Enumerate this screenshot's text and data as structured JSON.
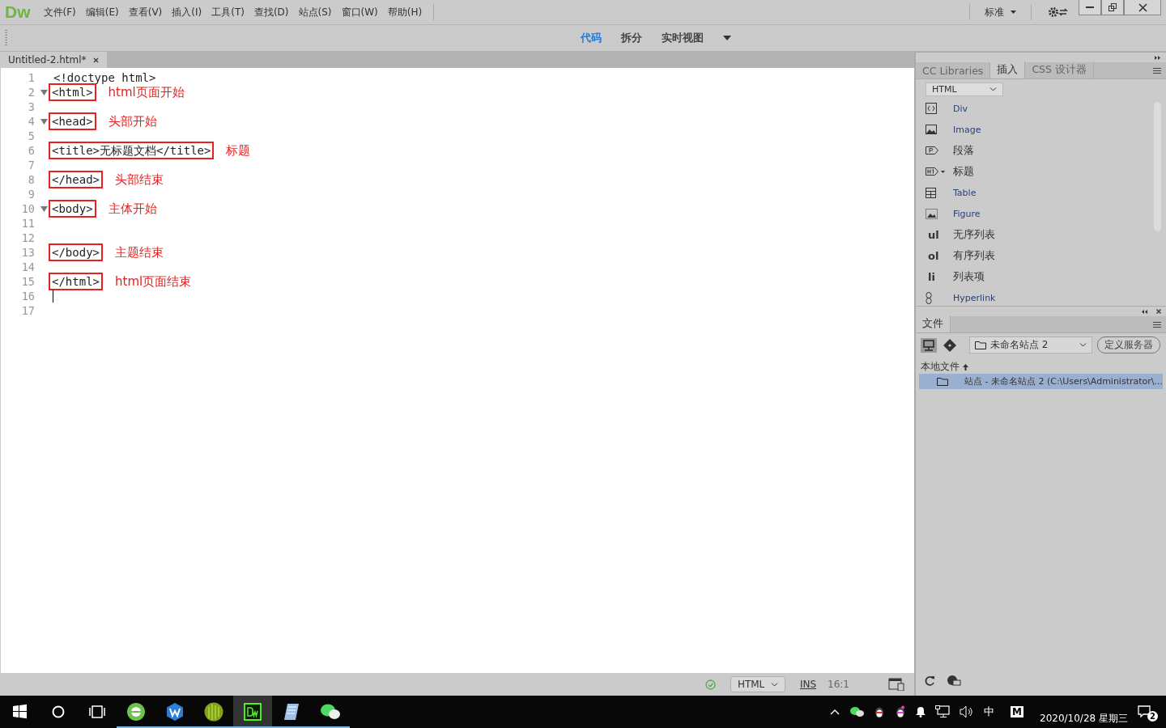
{
  "app_logo": "Dw",
  "menu": [
    "文件(F)",
    "编辑(E)",
    "查看(V)",
    "插入(I)",
    "工具(T)",
    "查找(D)",
    "站点(S)",
    "窗口(W)",
    "帮助(H)"
  ],
  "workspace": "标准",
  "view_modes": [
    {
      "label": "代码",
      "selected": true
    },
    {
      "label": "拆分",
      "selected": false
    },
    {
      "label": "实时视图",
      "selected": false
    }
  ],
  "document_tab": {
    "title": "Untitled-2.html*"
  },
  "code_lines": [
    {
      "number": "1",
      "code": "<!doctype html>",
      "fold": false,
      "boxed": false
    },
    {
      "number": "2",
      "code": "<html>",
      "fold": true,
      "boxed": true,
      "note": "html页面开始"
    },
    {
      "number": "3",
      "fold": false,
      "boxed": false
    },
    {
      "number": "4",
      "code": "<head>",
      "fold": true,
      "boxed": true,
      "note": "头部开始"
    },
    {
      "number": "5",
      "fold": false,
      "boxed": false
    },
    {
      "number": "6",
      "code": "<title>无标题文档</title>",
      "fold": false,
      "boxed": true,
      "note": "标题"
    },
    {
      "number": "7",
      "fold": false,
      "boxed": false
    },
    {
      "number": "8",
      "code": "</head>",
      "fold": false,
      "boxed": true,
      "note": "头部结束"
    },
    {
      "number": "9",
      "fold": false,
      "boxed": false
    },
    {
      "number": "10",
      "code": "<body>",
      "fold": true,
      "boxed": true,
      "note": "主体开始"
    },
    {
      "number": "11",
      "fold": false,
      "boxed": false
    },
    {
      "number": "12",
      "fold": false,
      "boxed": false
    },
    {
      "number": "13",
      "code": "</body>",
      "fold": false,
      "boxed": true,
      "note": "主题结束"
    },
    {
      "number": "14",
      "fold": false,
      "boxed": false
    },
    {
      "number": "15",
      "code": "</html>",
      "fold": false,
      "boxed": true,
      "note": "html页面结束"
    },
    {
      "number": "16",
      "fold": false,
      "boxed": false,
      "cursor": true
    },
    {
      "number": "17",
      "fold": false,
      "boxed": false
    }
  ],
  "status_bar": {
    "document_type": "HTML",
    "mode": "INS",
    "position": "16:1"
  },
  "insert_panel": {
    "tabs": [
      {
        "label": "CC Libraries",
        "selected": false
      },
      {
        "label": "插入",
        "selected": true
      },
      {
        "label": "CSS 设计器",
        "selected": false
      }
    ],
    "category": "HTML",
    "items": [
      {
        "kind": "div",
        "label": "Div"
      },
      {
        "kind": "image",
        "label": "Image"
      },
      {
        "kind": "paragraph",
        "label": "段落"
      },
      {
        "kind": "heading",
        "label": "标题"
      },
      {
        "kind": "table",
        "label": "Table"
      },
      {
        "kind": "figure",
        "label": "Figure"
      },
      {
        "kind": "text",
        "glyph": "ul",
        "label": "无序列表"
      },
      {
        "kind": "text",
        "glyph": "ol",
        "label": "有序列表"
      },
      {
        "kind": "text",
        "glyph": "li",
        "label": "列表项"
      },
      {
        "kind": "link",
        "label": "Hyperlink"
      }
    ]
  },
  "files_panel": {
    "tab": "文件",
    "site": "未命名站点 2",
    "server_button": "定义服务器",
    "local_files": "本地文件",
    "rows": [
      {
        "label": "站点 - 未命名站点 2 (C:\\Users\\Administrator\\...",
        "selected": true
      }
    ]
  },
  "taskbar": {
    "apps": [
      {
        "kind": "browser",
        "active": false
      },
      {
        "kind": "wps",
        "active": false
      },
      {
        "kind": "round",
        "active": false
      },
      {
        "kind": "dw",
        "active": true
      },
      {
        "kind": "notepad",
        "active": false
      },
      {
        "kind": "chat",
        "active": false
      }
    ],
    "ime": "中",
    "ime_mode": "M",
    "date": "2020/10/28 星期三",
    "notifications": "2"
  }
}
